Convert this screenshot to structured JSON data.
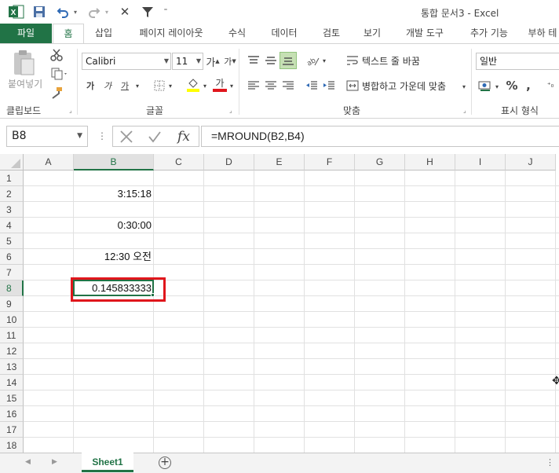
{
  "window": {
    "title": "통합 문서3 - Excel"
  },
  "ribbon": {
    "tabs": [
      {
        "label": "파일",
        "name": "tab-file"
      },
      {
        "label": "홈",
        "name": "tab-home"
      },
      {
        "label": "삽입",
        "name": "tab-insert"
      },
      {
        "label": "페이지 레이아웃",
        "name": "tab-page-layout"
      },
      {
        "label": "수식",
        "name": "tab-formulas"
      },
      {
        "label": "데이터",
        "name": "tab-data"
      },
      {
        "label": "검토",
        "name": "tab-review"
      },
      {
        "label": "보기",
        "name": "tab-view"
      },
      {
        "label": "개발 도구",
        "name": "tab-developer"
      },
      {
        "label": "추가 기능",
        "name": "tab-addins"
      },
      {
        "label": "부하 테",
        "name": "tab-load-test"
      }
    ],
    "clipboard": {
      "paste_label": "붙여넣기",
      "group_label": "클립보드"
    },
    "font": {
      "name": "Calibri",
      "size": "11",
      "bold": "가",
      "italic": "가",
      "underline": "가",
      "grow": "가",
      "shrink": "가",
      "font_color_glyph": "가",
      "group_label": "글꼴"
    },
    "alignment": {
      "wrap_text": "텍스트 줄 바꿈",
      "merge_center": "병합하고 가운데 맞춤",
      "group_label": "맞춤"
    },
    "number": {
      "format": "일반",
      "percent": "%",
      "comma": ",",
      "group_label": "표시 형식"
    },
    "accent_color": "#217346"
  },
  "formula_bar": {
    "name_box": "B8",
    "dots": "⋮",
    "formula": "=MROUND(B2,B4)",
    "fx": "fx"
  },
  "sheet": {
    "columns": [
      "A",
      "B",
      "C",
      "D",
      "E",
      "F",
      "G",
      "H",
      "I",
      "J"
    ],
    "rows": [
      "1",
      "2",
      "3",
      "4",
      "5",
      "6",
      "7",
      "8",
      "9",
      "10",
      "11",
      "12",
      "13",
      "14",
      "15",
      "16",
      "17",
      "18"
    ],
    "selected_cell": "B8",
    "cells": {
      "B2": "3:15:18",
      "B4": "0:30:00",
      "B6": "12:30 오전",
      "B8": "0.145833333"
    },
    "highlight_color": "#e0161c"
  },
  "sheet_tabs": {
    "active": "Sheet1",
    "add": "+"
  }
}
